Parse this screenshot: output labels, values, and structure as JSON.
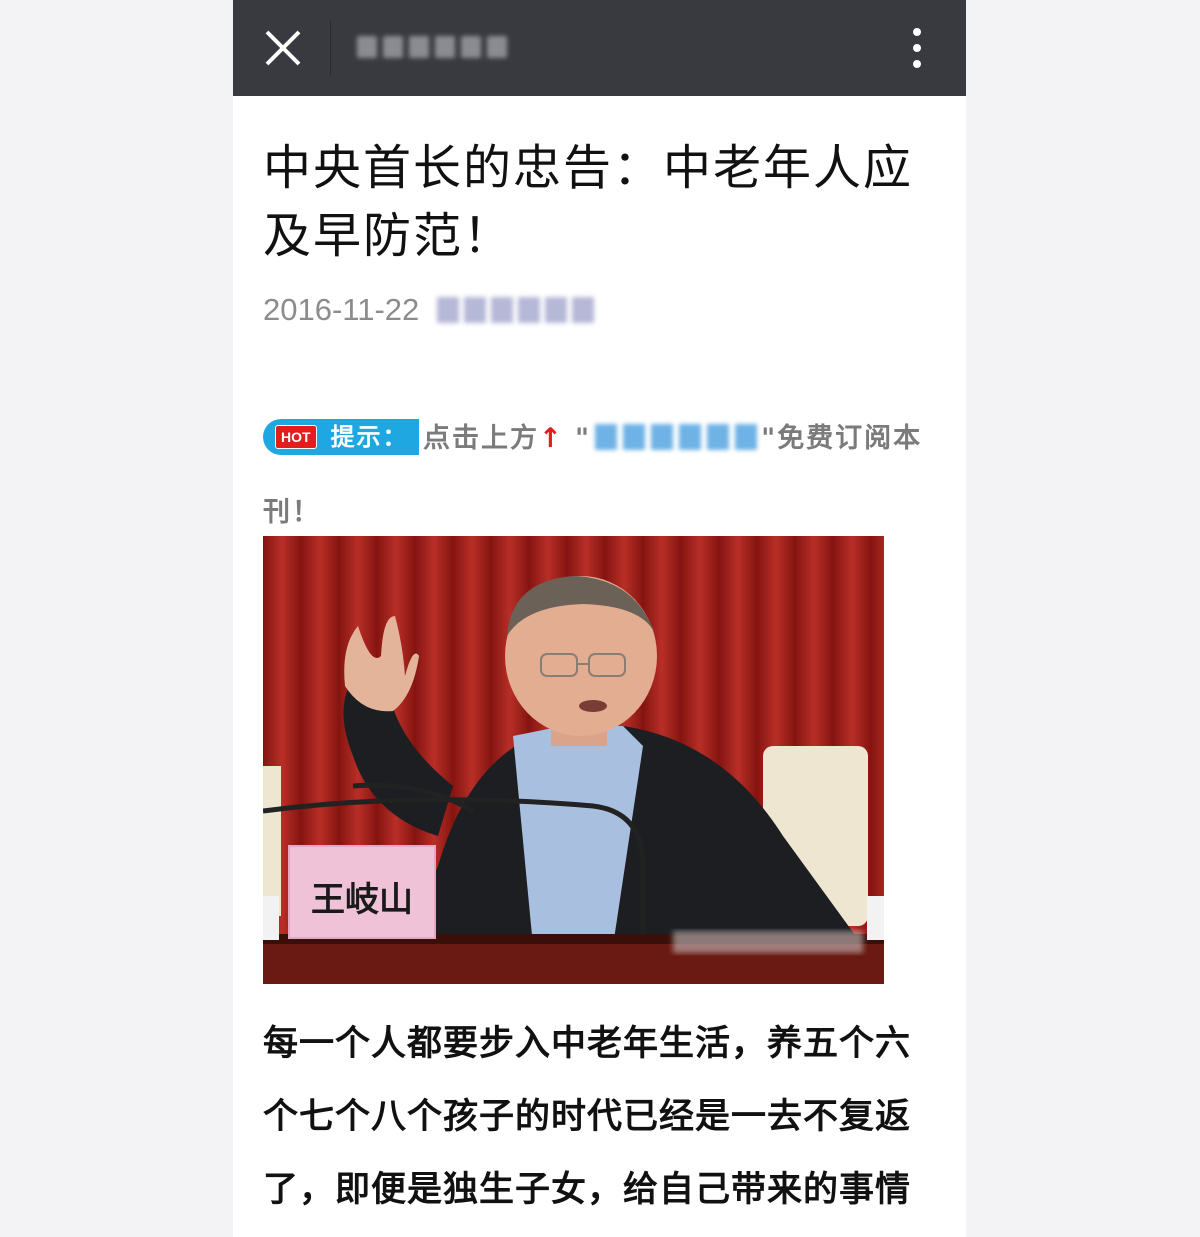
{
  "topbar": {
    "close_icon": "close-icon",
    "menu_icon": "more-vertical-icon",
    "background": "#393a3f"
  },
  "article": {
    "title": "中央首长的忠告：中老年人应及早防范！",
    "date": "2016-11-22",
    "hint": {
      "hot_tag": "HOT",
      "label": "提示：",
      "text_before": "点击上方",
      "arrow": "↑",
      "quote_open": "\"",
      "quote_close": "\"",
      "text_after": "免费订阅本刊！"
    },
    "photo": {
      "nameplate": "王岐山"
    },
    "body": "每一个人都要步入中老年生活，养五个六个七个八个孩子的时代已经是一去不复返了，即便是独生子女，给自己带来的事情"
  },
  "colors": {
    "accent_blue": "#1ea7e1",
    "hot_red": "#e41c1c",
    "curtain_red": "#b3241f"
  }
}
